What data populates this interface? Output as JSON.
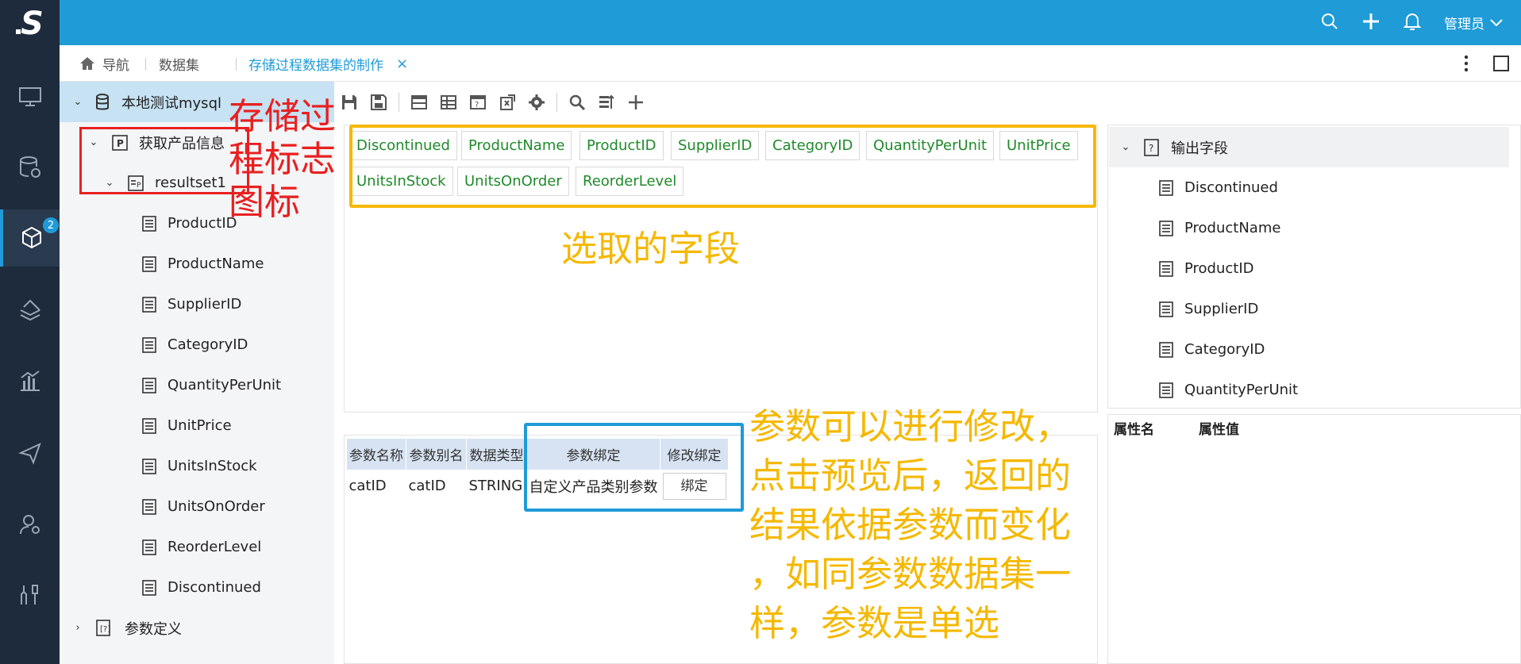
{
  "brand": {
    "logo_letter": "S"
  },
  "topbar": {
    "user": "管理员"
  },
  "rail": {
    "badge_count": "2"
  },
  "tabs": {
    "nav": "导航",
    "dataset": "数据集",
    "active": "存储过程数据集的制作",
    "close": "×"
  },
  "tree": {
    "root": "本地测试mysql",
    "procedure": "获取产品信息",
    "resultset": "resultset1",
    "fields": [
      "ProductID",
      "ProductName",
      "SupplierID",
      "CategoryID",
      "QuantityPerUnit",
      "UnitPrice",
      "UnitsInStock",
      "UnitsOnOrder",
      "ReorderLevel",
      "Discontinued"
    ],
    "params": "参数定义"
  },
  "selected_fields": [
    "Discontinued",
    "ProductName",
    "ProductID",
    "SupplierID",
    "CategoryID",
    "QuantityPerUnit",
    "UnitPrice",
    "UnitsInStock",
    "UnitsOnOrder",
    "ReorderLevel"
  ],
  "annotations": {
    "proc_icon_lines": [
      "存储过",
      "程标志",
      "图标"
    ],
    "selected_fields": "选取的字段",
    "param_note_lines": [
      "参数可以进行修改，",
      "点击预览后，返回的",
      "结果依据参数而变化",
      "，如同参数数据集一",
      "样，参数是单选"
    ]
  },
  "param_table": {
    "headers": [
      "参数名称",
      "参数别名",
      "数据类型",
      "参数绑定",
      "修改绑定"
    ],
    "row": {
      "name": "catID",
      "alias": "catID",
      "type": "STRING",
      "binding": "自定义产品类别参数",
      "button": "绑定"
    }
  },
  "output": {
    "title": "输出字段",
    "fields": [
      "Discontinued",
      "ProductName",
      "ProductID",
      "SupplierID",
      "CategoryID",
      "QuantityPerUnit"
    ]
  },
  "properties": {
    "name_col": "属性名",
    "value_col": "属性值"
  },
  "colors": {
    "topbar": "#1f9bd7",
    "rail": "#1e2b3c",
    "highlight_yellow": "#f5b800",
    "highlight_red": "#e82020",
    "chip_text": "#1f8a2a"
  }
}
